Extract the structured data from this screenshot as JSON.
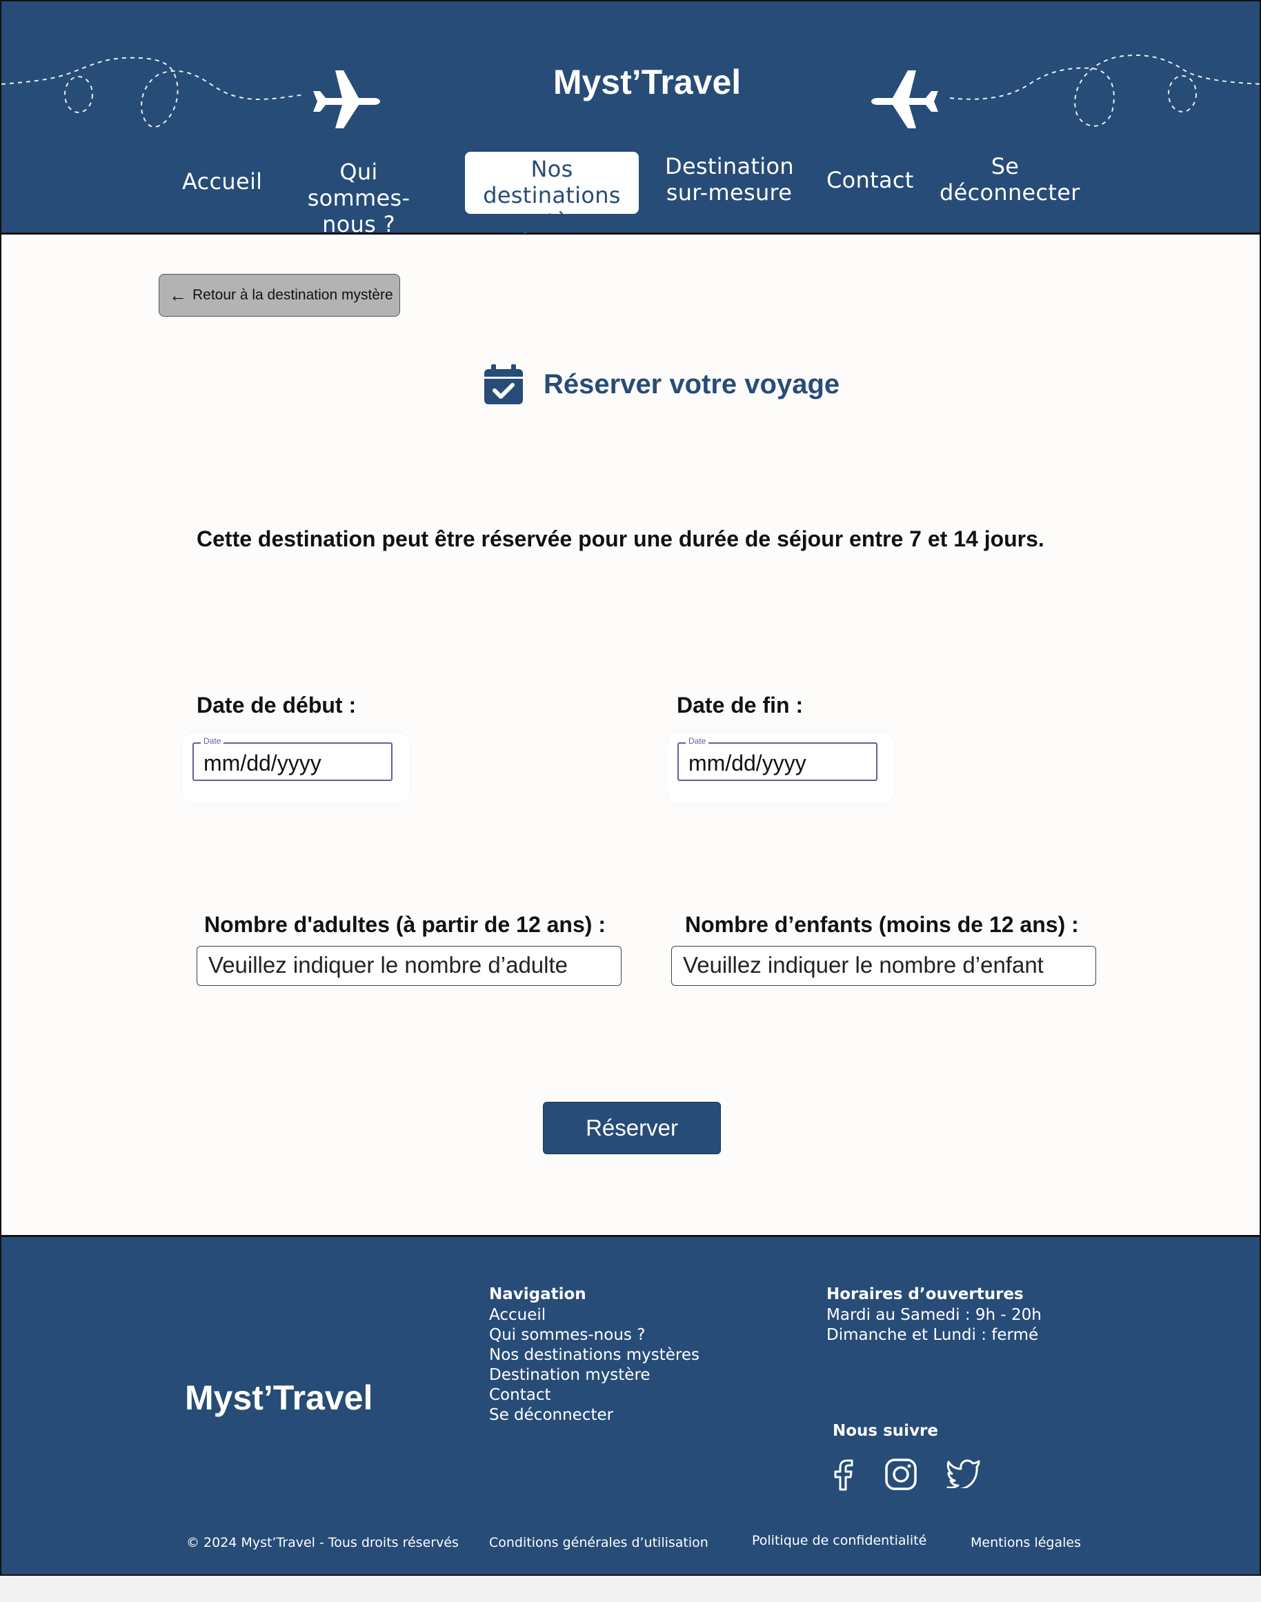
{
  "header": {
    "brand": "Myst’Travel",
    "nav": [
      {
        "label": "Accueil"
      },
      {
        "label": "Qui sommes-\nnous ?"
      },
      {
        "label": "Nos destinations\nmystères"
      },
      {
        "label": "Destination\nsur-mesure"
      },
      {
        "label": "Contact"
      },
      {
        "label": "Se\ndéconnecter"
      }
    ],
    "active_index": 2
  },
  "main": {
    "back_label": "Retour à la destination mystère",
    "title": "Réserver votre voyage",
    "info": "Cette destination peut être réservée pour une durée de séjour entre 7 et 14 jours.",
    "start_label": "Date de début :",
    "end_label": "Date de fin :",
    "date_mini_label": "Date",
    "date_placeholder": "mm/dd/yyyy",
    "adults_label": "Nombre d'adultes (à partir de 12 ans) :",
    "adults_placeholder": "Veuillez indiquer le nombre d’adulte",
    "children_label": "Nombre d’enfants (moins de 12 ans) :",
    "children_placeholder": "Veuillez indiquer le nombre d’enfant",
    "submit_label": "Réserver"
  },
  "footer": {
    "brand": "Myst’Travel",
    "nav_title": "Navigation",
    "nav_items": [
      "Accueil",
      "Qui sommes-nous ?",
      "Nos destinations mystères",
      "Destination mystère",
      "Contact",
      "Se déconnecter"
    ],
    "hours_title": "Horaires d’ouvertures",
    "hours": [
      "Mardi au Samedi : 9h - 20h",
      "Dimanche et Lundi : fermé"
    ],
    "follow_title": "Nous suivre",
    "socials": [
      "facebook-icon",
      "instagram-icon",
      "twitter-icon"
    ],
    "copyright": "© 2024 Myst’Travel - Tous droits réservés",
    "terms": "Conditions générales d’utilisation",
    "privacy": "Politique de confidentialité",
    "legal": "Mentions légales"
  },
  "colors": {
    "primary": "#274c77",
    "background": "#fdfcfa",
    "date_border": "#6c5a9c",
    "back_button": "#b3b3b3"
  }
}
